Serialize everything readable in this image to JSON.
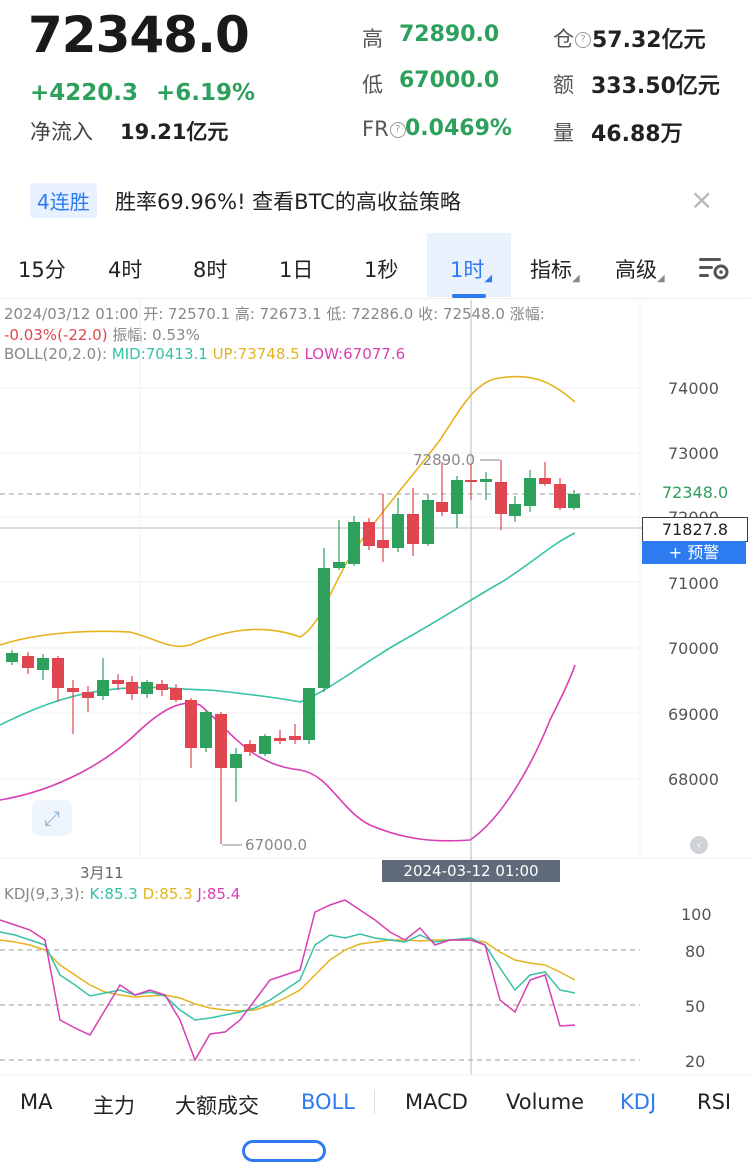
{
  "header": {
    "price": "72348.0",
    "change": "+4220.3",
    "change_pct": "+6.19%",
    "net_inflow_label": "净流入",
    "net_inflow_value": "19.21亿元",
    "high_label": "高",
    "high_value": "72890.0",
    "low_label": "低",
    "low_value": "67000.0",
    "fr_label": "FR",
    "fr_value": "0.0469%",
    "oi_label": "仓",
    "oi_value": "57.32亿元",
    "amount_label": "额",
    "amount_value": "333.50亿元",
    "volume_label": "量",
    "volume_value": "46.88万",
    "info_icon": "?"
  },
  "banner": {
    "badge": "4连胜",
    "text": "胜率69.96%! 查看BTC的高收益策略",
    "close_icon": "×"
  },
  "tabs": [
    {
      "label": "15分"
    },
    {
      "label": "4时"
    },
    {
      "label": "8时"
    },
    {
      "label": "1日"
    },
    {
      "label": "1秒"
    },
    {
      "label": "1时"
    },
    {
      "label": "指标"
    },
    {
      "label": "高级"
    }
  ],
  "chart_info": {
    "line1": "2024/03/12 01:00 开:  72570.1 高:  72673.1 低:  72286.0 收:  72548.0 涨幅:",
    "line2_red": "-0.03%(-22.0)",
    "line2_rest": " 振幅:  0.53%",
    "boll_label": "BOLL(20,2.0):",
    "boll_mid": "MID:70413.1",
    "boll_up": "UP:73748.5",
    "boll_low": "LOW:67077.6"
  },
  "price_axis": [
    "74000",
    "73000",
    "72000",
    "71000",
    "70000",
    "69000",
    "68000"
  ],
  "annotations": {
    "high_mark": "72890.0",
    "low_mark": "67000.0",
    "current_price": "72348.0",
    "crosshair_price": "71827.8",
    "alert_button": "+ 预警",
    "date_label": "3月11",
    "crosshair_date": "2024-03-12 01:00"
  },
  "kdj": {
    "label": "KDJ(9,3,3):",
    "k": "K:85.3",
    "d": "D:85.3",
    "j": "J:85.4",
    "axis": [
      "100",
      "80",
      "50",
      "20"
    ]
  },
  "colors": {
    "up": "#2da05c",
    "down": "#e0464f",
    "accent": "#2d7bf0",
    "boll_mid": "#35c2a5",
    "boll_up": "#e6b320",
    "boll_low": "#d83fb4"
  },
  "bottom_tabs": [
    {
      "label": "MA"
    },
    {
      "label": "主力"
    },
    {
      "label": "大额成交"
    },
    {
      "label": "BOLL"
    },
    {
      "label": "MACD"
    },
    {
      "label": "Volume"
    },
    {
      "label": "KDJ"
    },
    {
      "label": "RSI"
    }
  ]
}
